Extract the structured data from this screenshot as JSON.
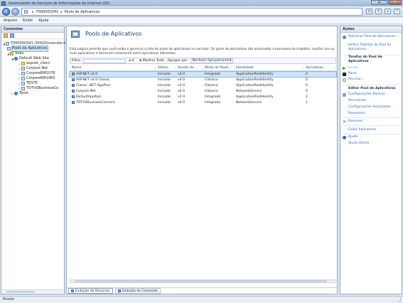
{
  "window": {
    "title": "Gerenciador de Serviços de Informações da Internet (IIS)"
  },
  "address": {
    "crumbs": [
      "T000000341",
      "Pools de Aplicativos"
    ]
  },
  "menu": {
    "items": [
      "Arquivo",
      "Exibir",
      "Ajuda"
    ]
  },
  "connections": {
    "header": "Conexões",
    "tree": {
      "server": "T000000341 (DHGO\\marcelo.o",
      "app_pools": "Pools de Aplicativos",
      "sites": "Sites",
      "default_site": "Default Web Site",
      "children": [
        "aspnet_client",
        "Corpore.Net",
        "CorporeRM1076",
        "CorporeRM1083",
        "TESTE",
        "TOTVSBusinessCo"
      ],
      "teste": "Teste"
    }
  },
  "main": {
    "title": "Pools de Aplicativos",
    "description": "Esta página permite que você exiba e gerencie a lista de pools de aplicativos no servidor. Os pools de aplicativos são associados a processos de trabalho, contêm um ou mais aplicativos e fornecem isolamento entre aplicativos diferentes.",
    "filter": {
      "label": "Filtro:",
      "go": "Ir",
      "show_all": "Mostrar Tudo",
      "group_label": "Agrupar por:",
      "group_value": "Nenhum Agrupamento"
    },
    "columns": [
      "Nome",
      "Status",
      "Versão do ...",
      "Modo de Pipeli...",
      "Identidade",
      "Aplicativos"
    ],
    "rows": [
      [
        "ASP.NET v4.0",
        "Iniciado",
        "v4.0",
        "Integrado",
        "ApplicationPoolIdentity",
        "0"
      ],
      [
        "ASP.NET v4.0 Classic",
        "Iniciado",
        "v4.0",
        "Clássico",
        "ApplicationPoolIdentity",
        "0"
      ],
      [
        "Classic .NET AppPool",
        "Iniciado",
        "v2.0",
        "Clássico",
        "ApplicationPoolIdentity",
        "0"
      ],
      [
        "Corpore.Net",
        "Iniciado",
        "v4.0",
        "Clássico",
        "NetworkService",
        "0"
      ],
      [
        "DefaultAppPool",
        "Iniciado",
        "v2.0",
        "Integrado",
        "ApplicationPoolIdentity",
        "2"
      ],
      [
        "TOTVSBusinessConnect",
        "Iniciado",
        "v4.0",
        "Integrado",
        "NetworkService",
        "1"
      ]
    ],
    "view_tabs": [
      "Exibição de Recursos",
      "Exibição de Conteúdo"
    ]
  },
  "actions": {
    "header": "Ações",
    "add_pool": "Adicionar Pool de Aplicativos...",
    "set_defaults": "Definir Padrões do Pool de Aplicativos...",
    "tasks_header": "Tarefas do Pool de Aplicativos",
    "start": "Iniciar",
    "stop": "Parar",
    "recycle": "Reciclar...",
    "edit_header": "Editar Pool de Aplicativos",
    "basic_settings": "Configurações Básicas...",
    "recycling": "Reciclando...",
    "advanced_settings": "Configurações Avançadas...",
    "rename": "Renomear",
    "remove": "Remover",
    "view_apps": "Exibir Aplicativos",
    "help": "Ajuda",
    "online_help": "Ajuda Online"
  },
  "status": {
    "text": "Pronto"
  }
}
